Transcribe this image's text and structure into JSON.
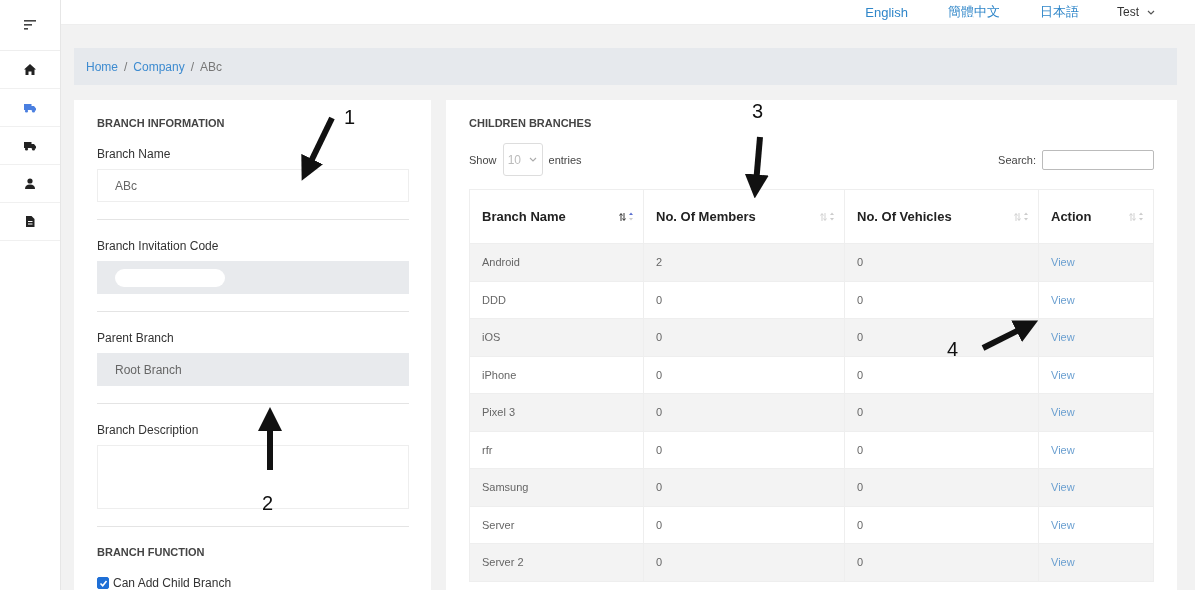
{
  "topbar": {
    "languages": [
      "English",
      "簡體中文",
      "日本語"
    ],
    "user": "Test"
  },
  "sidebar": {
    "items": [
      {
        "selected": false
      },
      {
        "selected": true
      },
      {
        "selected": false
      },
      {
        "selected": false
      },
      {
        "selected": false
      }
    ]
  },
  "breadcrumb": {
    "links": [
      "Home",
      "Company"
    ],
    "separators": [
      "/",
      "/"
    ],
    "current": "ABc"
  },
  "branch_information": {
    "heading": "BRANCH INFORMATION",
    "fields": [
      {
        "label": "Branch Name",
        "value": "ABc",
        "disabled": false,
        "redacted": false,
        "kind": "input"
      },
      {
        "label": "Branch Invitation Code",
        "disabled": true,
        "redacted": true,
        "kind": "input"
      },
      {
        "label": "Parent Branch",
        "value": "Root Branch",
        "disabled": true,
        "redacted": false,
        "kind": "input"
      },
      {
        "label": "Branch Description",
        "disabled": false,
        "redacted": false,
        "kind": "textarea"
      }
    ]
  },
  "branch_function": {
    "heading": "BRANCH FUNCTION",
    "options": [
      {
        "label": "Can Add Child Branch",
        "checked": true
      }
    ]
  },
  "children_branches": {
    "heading": "CHILDREN BRANCHES",
    "show_label": "Show",
    "entries_value": "10",
    "entries_label": "entries",
    "search_label": "Search:",
    "columns": [
      {
        "label": "Branch Name",
        "sorted": true
      },
      {
        "label": "No. Of Members",
        "sorted": false
      },
      {
        "label": "No. Of Vehicles",
        "sorted": false
      },
      {
        "label": "Action",
        "sorted": false
      }
    ],
    "rows": [
      {
        "name": "Android",
        "members": "2",
        "vehicles": "0",
        "action": "View"
      },
      {
        "name": "DDD",
        "members": "0",
        "vehicles": "0",
        "action": "View"
      },
      {
        "name": "iOS",
        "members": "0",
        "vehicles": "0",
        "action": "View"
      },
      {
        "name": "iPhone",
        "members": "0",
        "vehicles": "0",
        "action": "View"
      },
      {
        "name": "Pixel 3",
        "members": "0",
        "vehicles": "0",
        "action": "View"
      },
      {
        "name": "rfr",
        "members": "0",
        "vehicles": "0",
        "action": "View"
      },
      {
        "name": "Samsung",
        "members": "0",
        "vehicles": "0",
        "action": "View"
      },
      {
        "name": "Server",
        "members": "0",
        "vehicles": "0",
        "action": "View"
      },
      {
        "name": "Server 2",
        "members": "0",
        "vehicles": "0",
        "action": "View"
      }
    ]
  },
  "callouts": [
    {
      "label": "1"
    },
    {
      "label": "2"
    },
    {
      "label": "3"
    },
    {
      "label": "4"
    }
  ]
}
